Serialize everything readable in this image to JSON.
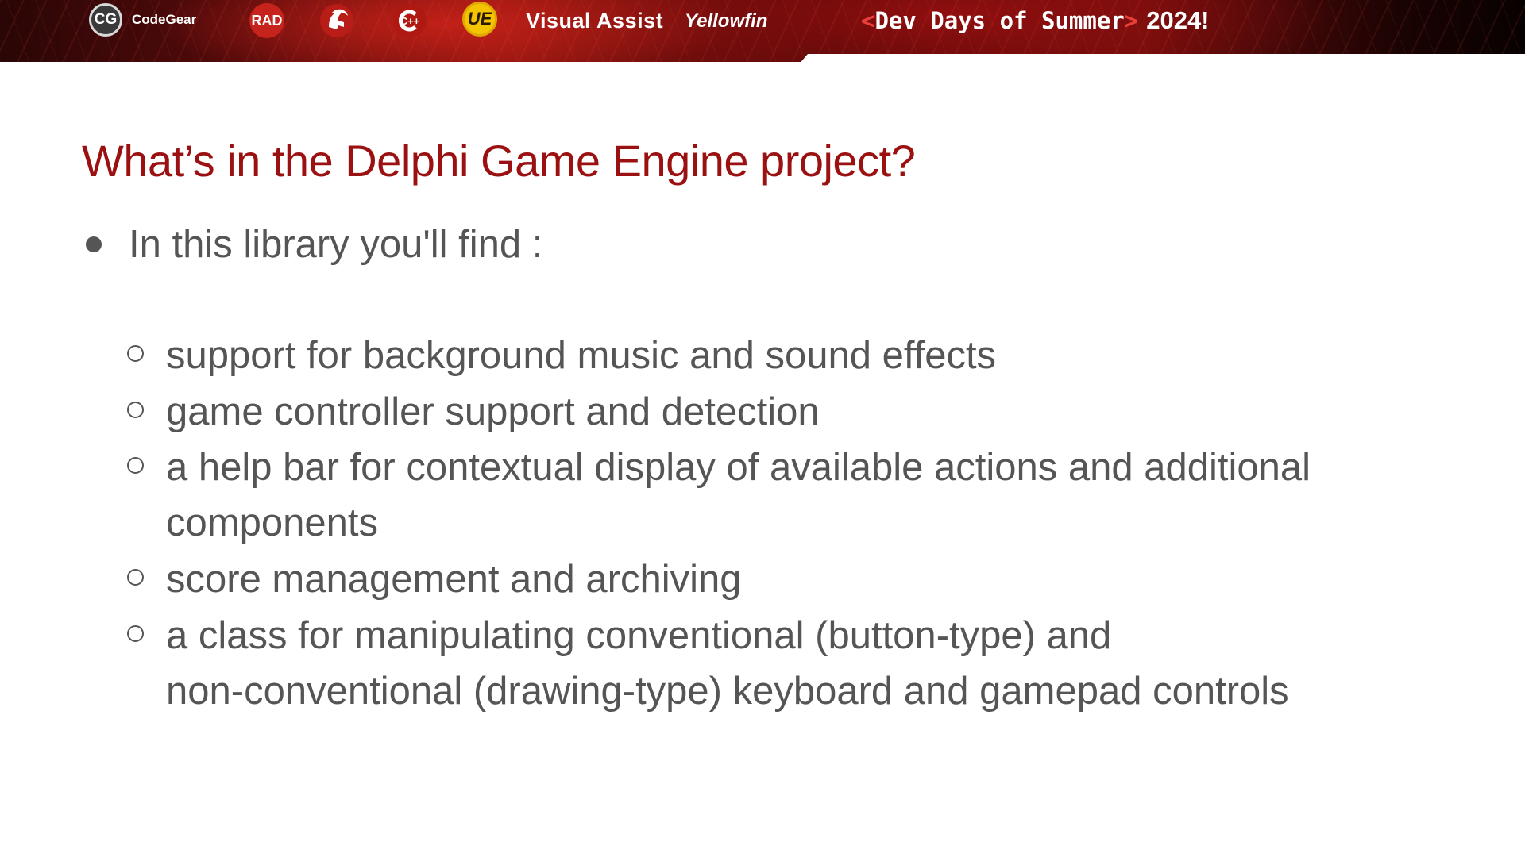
{
  "banner": {
    "logos": {
      "codegear_badge": "CG",
      "codegear_name": "CodeGear",
      "rad_badge": "RAD",
      "cpp_badge": "C++",
      "ue_badge": "UE",
      "visual_assist": "Visual Assist",
      "yellowfin": "Yellowfin"
    },
    "event": {
      "open_bracket": "<",
      "name": "Dev Days of Summer",
      "close_bracket": ">",
      "year": "2024!"
    },
    "colors": {
      "accent_red": "#e8413a",
      "title_red": "#9b1111",
      "text_gray": "#555555"
    }
  },
  "slide": {
    "title": "What’s in the Delphi Game Engine project?",
    "intro": "In this library you'll find :",
    "items": [
      {
        "lines": [
          "support for background music and sound effects"
        ]
      },
      {
        "lines": [
          "game controller support and detection"
        ]
      },
      {
        "lines": [
          "a help bar for contextual display of available actions and additional",
          "components"
        ]
      },
      {
        "lines": [
          "score management and archiving"
        ]
      },
      {
        "lines": [
          "a class for manipulating conventional (button-type) and",
          "non-conventional (drawing-type) keyboard and gamepad controls"
        ]
      }
    ]
  }
}
